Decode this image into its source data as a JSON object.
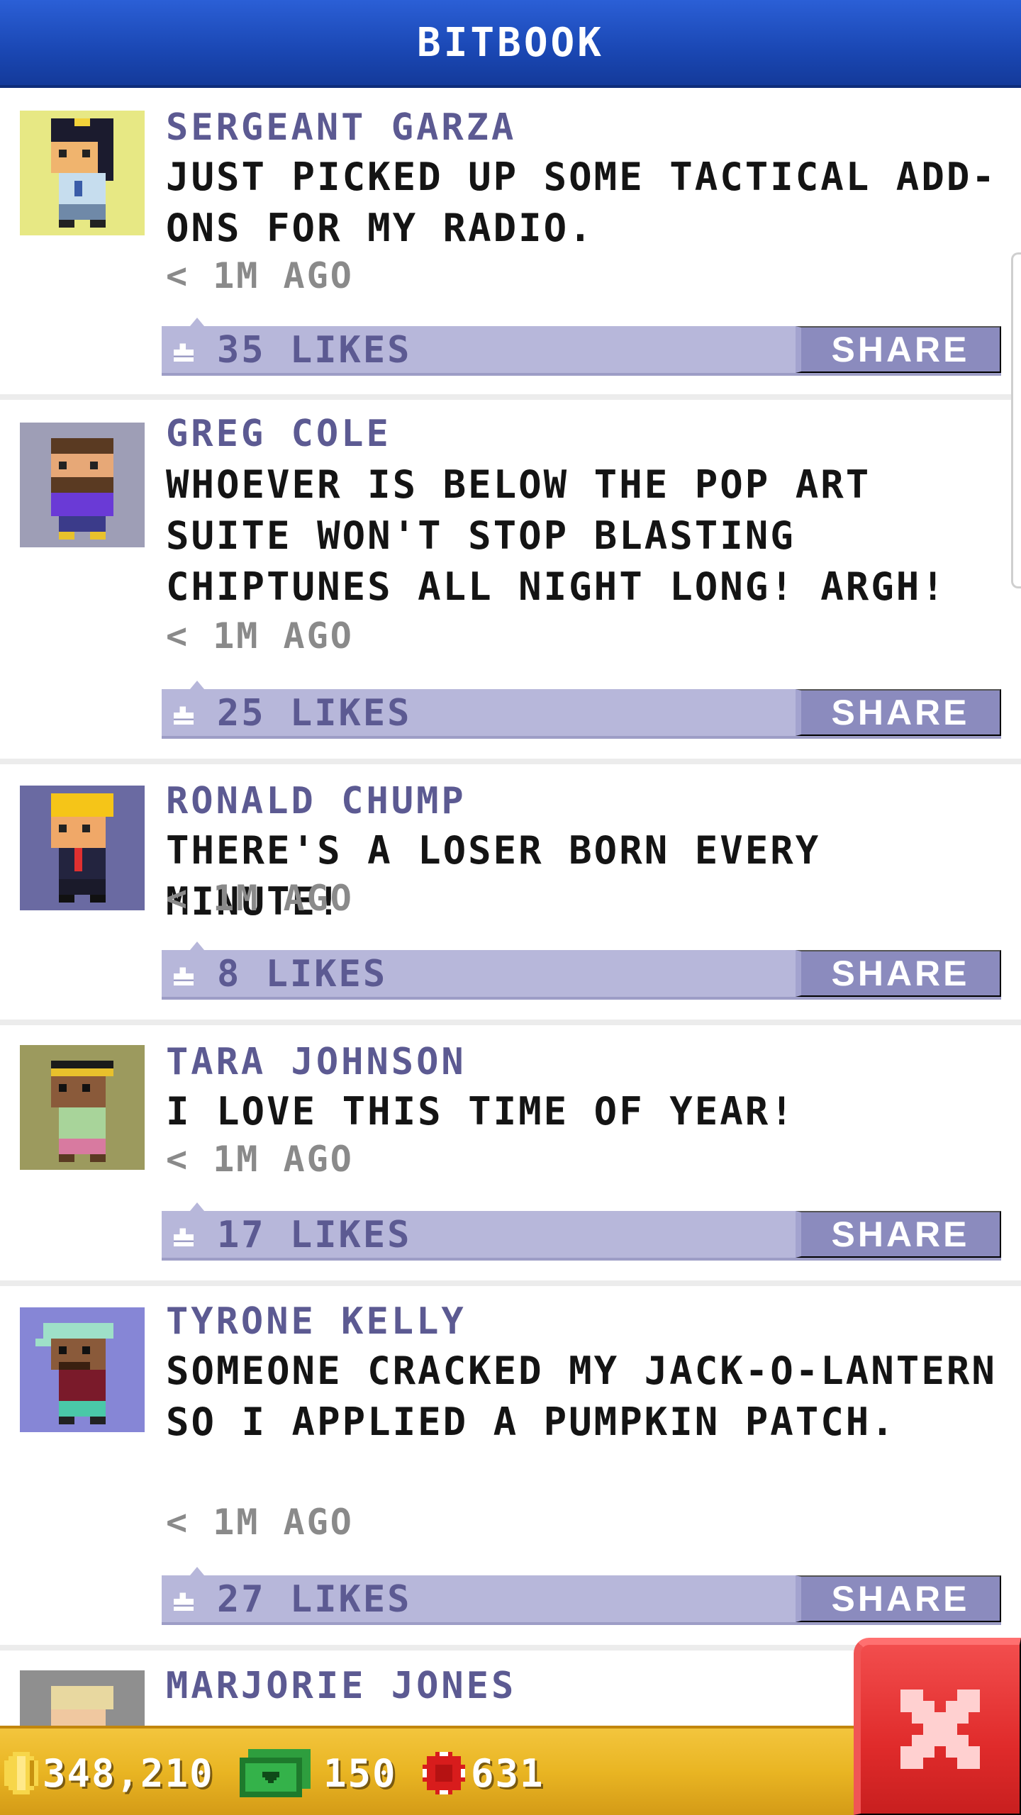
{
  "header": {
    "title": "BITBOOK"
  },
  "posts": [
    {
      "name": "SERGEANT GARZA",
      "message": "JUST PICKED UP SOME TACTICAL ADD-ONS FOR MY RADIO.",
      "time": "< 1M AGO",
      "likes": "35 LIKES",
      "share": "SHARE",
      "avatar_bg": "#e7e884"
    },
    {
      "name": "GREG COLE",
      "message": "WHOEVER IS BELOW THE POP ART SUITE WON'T STOP BLASTING CHIPTUNES ALL NIGHT LONG! ARGH!",
      "time": "< 1M AGO",
      "likes": "25 LIKES",
      "share": "SHARE",
      "avatar_bg": "#9e9eb6"
    },
    {
      "name": "RONALD CHUMP",
      "message": "THERE'S A LOSER BORN EVERY MINUTE!",
      "time": "< 1M AGO",
      "likes": "8 LIKES",
      "share": "SHARE",
      "avatar_bg": "#6a6aa2"
    },
    {
      "name": "TARA JOHNSON",
      "message": "I LOVE THIS TIME OF YEAR!",
      "time": "< 1M AGO",
      "likes": "17 LIKES",
      "share": "SHARE",
      "avatar_bg": "#9c9a5e"
    },
    {
      "name": "TYRONE KELLY",
      "message": "SOMEONE CRACKED MY JACK-O-LANTERN SO I APPLIED A PUMPKIN PATCH.",
      "time": "< 1M AGO",
      "likes": "27 LIKES",
      "share": "SHARE",
      "avatar_bg": "#8686d6"
    },
    {
      "name": "MARJORIE JONES",
      "avatar_bg": "#8f8f8f"
    }
  ],
  "footer": {
    "coins": "348,210",
    "bux": "150",
    "tokens": "631"
  },
  "colors": {
    "header_blue": "#1a47b3",
    "name_purple": "#5c5a92",
    "like_bar": "#b7b7da",
    "share_button": "#8b8bbe",
    "footer_gold": "#e9b523",
    "close_red": "#e02b2b"
  },
  "icons": {
    "like": "like-icon",
    "coin": "coin-icon",
    "bux": "bux-icon",
    "token": "token-icon",
    "close": "close-icon"
  }
}
